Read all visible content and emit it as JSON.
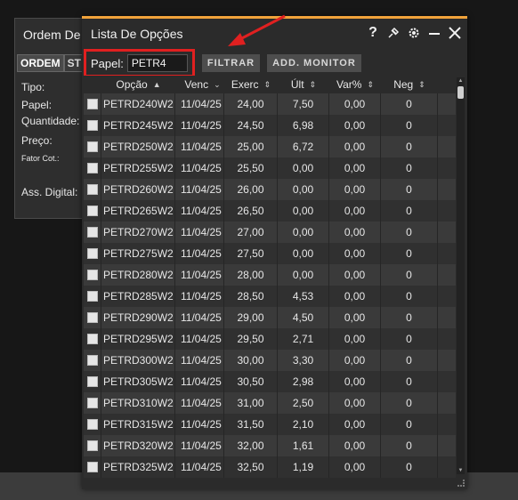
{
  "order_window": {
    "title": "Ordem De",
    "tabs": [
      "ORDEM",
      "ST"
    ],
    "labels": {
      "tipo": "Tipo:",
      "papel": "Papel:",
      "quantidade": "Quantidade:",
      "preco": "Preço:",
      "fator": "Fator Cot.:",
      "ass": "Ass. Digital:"
    }
  },
  "options_window": {
    "title": "Lista De Opções",
    "icons": [
      "help-icon",
      "pin-icon",
      "gear-icon",
      "minimize-icon",
      "close-icon"
    ],
    "help_glyph": "?",
    "filter": {
      "label": "Papel:",
      "value": "PETR4",
      "filter_button": "FILTRAR",
      "monitor_button": "ADD. MONITOR"
    },
    "columns": [
      "Opção",
      "Venc",
      "Exerc",
      "Últ",
      "Var%",
      "Neg"
    ],
    "rows": [
      {
        "opcao": "PETRD240W2",
        "venc": "11/04/25",
        "exerc": "24,00",
        "ult": "7,50",
        "var": "0,00",
        "neg": "0"
      },
      {
        "opcao": "PETRD245W2",
        "venc": "11/04/25",
        "exerc": "24,50",
        "ult": "6,98",
        "var": "0,00",
        "neg": "0"
      },
      {
        "opcao": "PETRD250W2",
        "venc": "11/04/25",
        "exerc": "25,00",
        "ult": "6,72",
        "var": "0,00",
        "neg": "0"
      },
      {
        "opcao": "PETRD255W2",
        "venc": "11/04/25",
        "exerc": "25,50",
        "ult": "0,00",
        "var": "0,00",
        "neg": "0"
      },
      {
        "opcao": "PETRD260W2",
        "venc": "11/04/25",
        "exerc": "26,00",
        "ult": "0,00",
        "var": "0,00",
        "neg": "0"
      },
      {
        "opcao": "PETRD265W2",
        "venc": "11/04/25",
        "exerc": "26,50",
        "ult": "0,00",
        "var": "0,00",
        "neg": "0"
      },
      {
        "opcao": "PETRD270W2",
        "venc": "11/04/25",
        "exerc": "27,00",
        "ult": "0,00",
        "var": "0,00",
        "neg": "0"
      },
      {
        "opcao": "PETRD275W2",
        "venc": "11/04/25",
        "exerc": "27,50",
        "ult": "0,00",
        "var": "0,00",
        "neg": "0"
      },
      {
        "opcao": "PETRD280W2",
        "venc": "11/04/25",
        "exerc": "28,00",
        "ult": "0,00",
        "var": "0,00",
        "neg": "0"
      },
      {
        "opcao": "PETRD285W2",
        "venc": "11/04/25",
        "exerc": "28,50",
        "ult": "4,53",
        "var": "0,00",
        "neg": "0"
      },
      {
        "opcao": "PETRD290W2",
        "venc": "11/04/25",
        "exerc": "29,00",
        "ult": "4,50",
        "var": "0,00",
        "neg": "0"
      },
      {
        "opcao": "PETRD295W2",
        "venc": "11/04/25",
        "exerc": "29,50",
        "ult": "2,71",
        "var": "0,00",
        "neg": "0"
      },
      {
        "opcao": "PETRD300W2",
        "venc": "11/04/25",
        "exerc": "30,00",
        "ult": "3,30",
        "var": "0,00",
        "neg": "0"
      },
      {
        "opcao": "PETRD305W2",
        "venc": "11/04/25",
        "exerc": "30,50",
        "ult": "2,98",
        "var": "0,00",
        "neg": "0"
      },
      {
        "opcao": "PETRD310W2",
        "venc": "11/04/25",
        "exerc": "31,00",
        "ult": "2,50",
        "var": "0,00",
        "neg": "0"
      },
      {
        "opcao": "PETRD315W2",
        "venc": "11/04/25",
        "exerc": "31,50",
        "ult": "2,10",
        "var": "0,00",
        "neg": "0"
      },
      {
        "opcao": "PETRD320W2",
        "venc": "11/04/25",
        "exerc": "32,00",
        "ult": "1,61",
        "var": "0,00",
        "neg": "0"
      },
      {
        "opcao": "PETRD325W2",
        "venc": "11/04/25",
        "exerc": "32,50",
        "ult": "1,19",
        "var": "0,00",
        "neg": "0"
      }
    ]
  },
  "colors": {
    "accent_border": "#f0a23a",
    "highlight_box": "#e02020",
    "annotation_arrow": "#e02020"
  }
}
